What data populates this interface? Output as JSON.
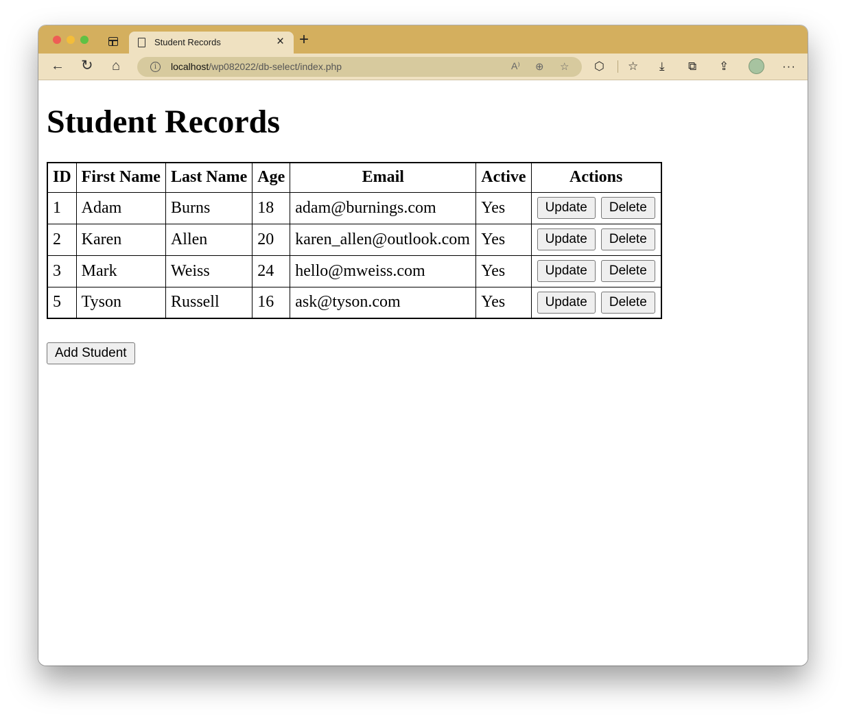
{
  "browser": {
    "tab_title": "Student Records",
    "tab_close": "×",
    "new_tab": "+",
    "info_glyph": "i",
    "url_host": "localhost",
    "url_path": "/wp082022/db-select/index.php",
    "icons": {
      "back": "←",
      "refresh": "↻",
      "home": "⌂",
      "read_aloud": "A⁾",
      "zoom": "⊕",
      "favorite_add": "☆",
      "extensions": "⬡",
      "favorites": "☆",
      "downloads": "⤓",
      "collections": "⧉",
      "share": "⇪",
      "more": "···"
    }
  },
  "page": {
    "title": "Student Records",
    "table": {
      "headers": [
        "ID",
        "First Name",
        "Last Name",
        "Age",
        "Email",
        "Active",
        "Actions"
      ],
      "rows": [
        {
          "id": "1",
          "first": "Adam",
          "last": "Burns",
          "age": "18",
          "email": "adam@burnings.com",
          "active": "Yes"
        },
        {
          "id": "2",
          "first": "Karen",
          "last": "Allen",
          "age": "20",
          "email": "karen_allen@outlook.com",
          "active": "Yes"
        },
        {
          "id": "3",
          "first": "Mark",
          "last": "Weiss",
          "age": "24",
          "email": "hello@mweiss.com",
          "active": "Yes"
        },
        {
          "id": "5",
          "first": "Tyson",
          "last": "Russell",
          "age": "16",
          "email": "ask@tyson.com",
          "active": "Yes"
        }
      ],
      "update_label": "Update",
      "delete_label": "Delete"
    },
    "add_button_label": "Add Student"
  }
}
